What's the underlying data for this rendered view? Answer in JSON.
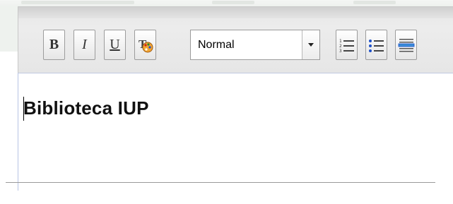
{
  "toolbar": {
    "bold_label": "B",
    "italic_label": "I",
    "underline_label": "U",
    "text_color_icon": "text-color-palette-icon",
    "format_select": {
      "selected": "Normal"
    },
    "ordered_list_icon": "ordered-list-icon",
    "unordered_list_icon": "unordered-list-icon",
    "horizontal_rule_icon": "horizontal-rule-icon"
  },
  "editor": {
    "content": "Biblioteca IUP"
  },
  "colors": {
    "toolbar_bg": "#e8e8e8",
    "button_border": "#9c9c9c",
    "content_border": "#b8c4e4",
    "list_blue": "#1e50c8",
    "palette_orange": "#e08a1e"
  }
}
